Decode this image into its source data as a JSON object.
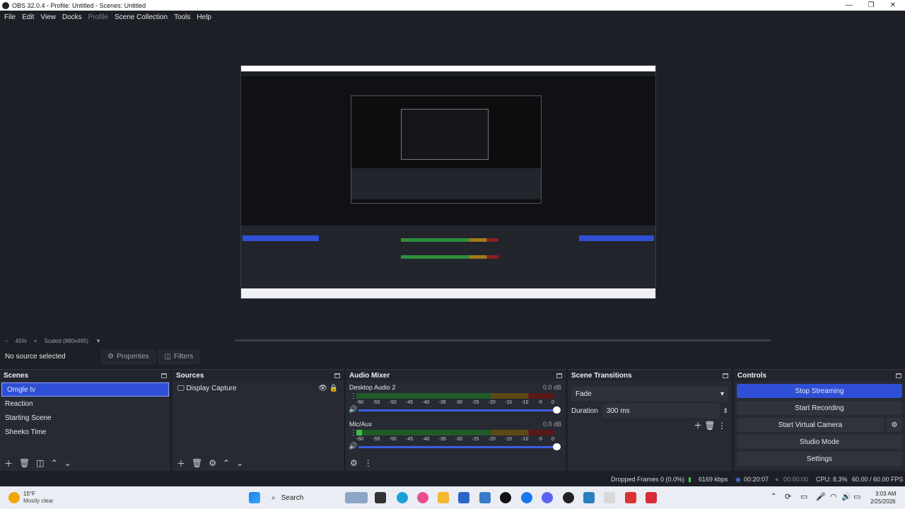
{
  "window": {
    "title": "OBS 32.0.4 - Profile: Untitled - Scenes: Untitled"
  },
  "menu": [
    "File",
    "Edit",
    "View",
    "Docks",
    "Profile",
    "Scene Collection",
    "Tools",
    "Help"
  ],
  "zoom": {
    "minus": "−",
    "level": "45%",
    "plus": "+",
    "scaled": "Scaled (880x495)"
  },
  "source_bar": {
    "no_source": "No source selected",
    "properties": "Properties",
    "filters": "Filters"
  },
  "scenes": {
    "title": "Scenes",
    "items": [
      "Omgle tv",
      "Reaction",
      "Starting Scene",
      "Sheeko Time"
    ],
    "active_index": 0
  },
  "sources": {
    "title": "Sources",
    "items": [
      "Display Capture"
    ]
  },
  "audio_mixer": {
    "title": "Audio Mixer",
    "channels": [
      {
        "name": "Desktop Audio 2",
        "db": "0.0 dB",
        "level": 0.0
      },
      {
        "name": "Mic/Aux",
        "db": "0.0 dB",
        "level": 0.03
      }
    ],
    "ticks": [
      "-60",
      "-55",
      "-50",
      "-45",
      "-40",
      "-35",
      "-30",
      "-25",
      "-20",
      "-15",
      "-10",
      "-5",
      "0"
    ]
  },
  "scene_transitions": {
    "title": "Scene Transitions",
    "transition": "Fade",
    "duration_label": "Duration",
    "duration": "300 ms"
  },
  "controls": {
    "title": "Controls",
    "stop_streaming": "Stop Streaming",
    "start_recording": "Start Recording",
    "start_virtual_camera": "Start Virtual Camera",
    "studio_mode": "Studio Mode",
    "settings": "Settings"
  },
  "status": {
    "dropped_frames": "Dropped Frames 0 (0.0%)",
    "bitrate": "6169 kbps",
    "stream_time": "00:20:07",
    "rec_time": "00:00:00",
    "cpu": "CPU: 8.3%",
    "fps": "60.00 / 60.00 FPS"
  },
  "taskbar": {
    "weather_temp": "15°F",
    "weather_desc": "Mostly clear",
    "search": "Search",
    "time": "3:03 AM",
    "date": "2/25/2026"
  },
  "colors": {
    "accent": "#2f4fd6",
    "bg": "#1d1f26",
    "dock": "#272a33"
  }
}
